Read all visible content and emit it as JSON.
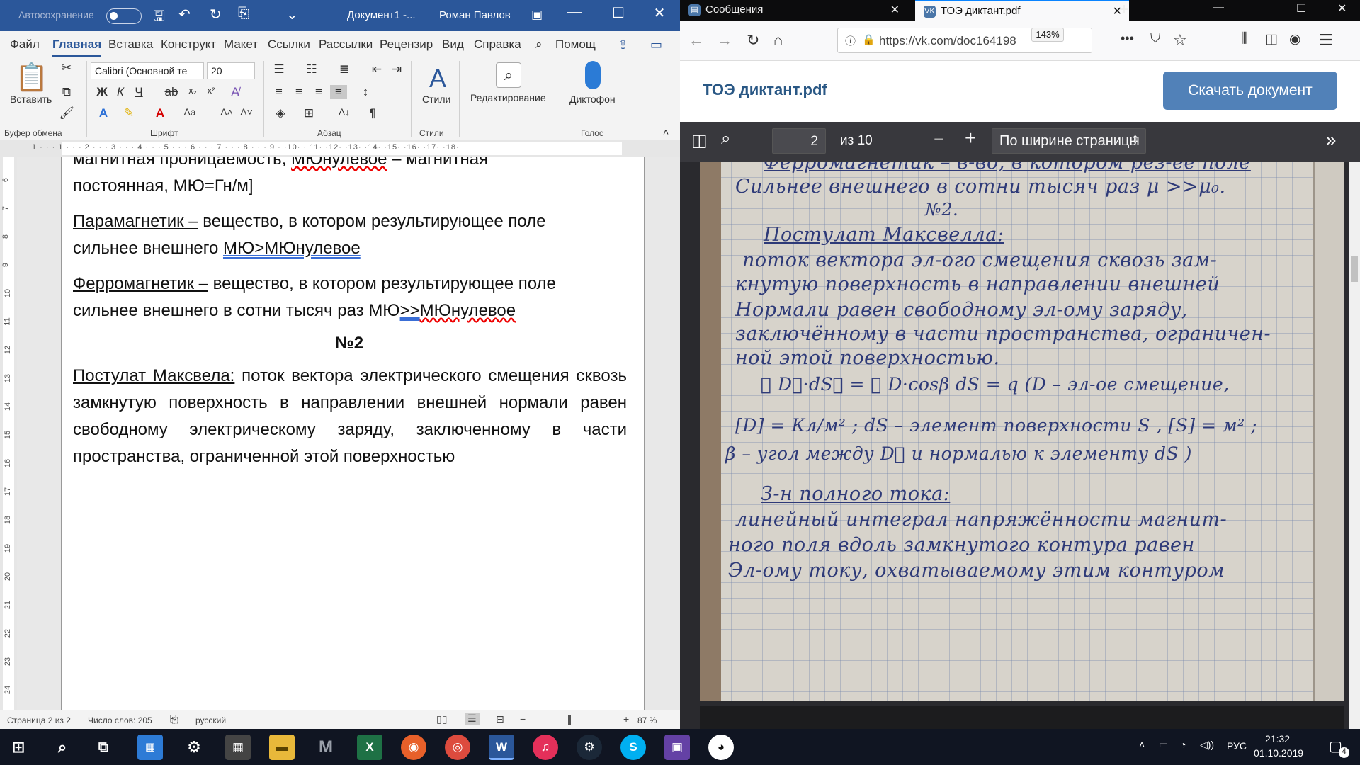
{
  "word": {
    "autosave_label": "Автосохранение",
    "doc_title": "Документ1  -...",
    "user_name": "Роман Павлов",
    "tabs": [
      "Файл",
      "Главная",
      "Вставка",
      "Конструкт",
      "Макет",
      "Ссылки",
      "Рассылки",
      "Рецензир",
      "Вид",
      "Справка",
      "Помощ"
    ],
    "ribbon": {
      "paste_label": "Вставить",
      "font_name": "Calibri (Основной те",
      "font_size": "20",
      "bold": "Ж",
      "italic": "К",
      "underline": "Ч",
      "strike": "ab",
      "styles_label": "Стили",
      "editing_label": "Редактирование",
      "dictate_label": "Диктофон",
      "groups": [
        "Буфер обмена",
        "Шрифт",
        "Абзац",
        "Стили",
        "Голос"
      ]
    },
    "ruler_numbers": "1 · · · 1 · · · 2 · · · 3 · · · 4 · · · 5 · · · 6 · · · 7 · · · 8 · · · 9 · ·10· · 11· ·12· ·13· ·14· ·15· ·16· ·17· ·18·",
    "vruler": [
      "6",
      "7",
      "8",
      "9",
      "10",
      "11",
      "12",
      "13",
      "14",
      "15",
      "16",
      "17",
      "18",
      "19",
      "20",
      "21",
      "22",
      "23",
      "24"
    ],
    "doc": {
      "cut_line_a": "магнитная проницаемость, ",
      "cut_line_b": "МЮнулевое",
      "cut_line_c": " – магнитная",
      "line2": "постоянная, МЮ=Гн/м]",
      "para_term": "Парамагнетик –",
      "para_text": " вещество, в котором результирующее поле",
      "para_line2a": "сильнее внешнего ",
      "para_line2b": "МЮ>МЮнулевое",
      "ferro_term": "Ферромагнетик –",
      "ferro_text": " вещество, в котором результирующее поле",
      "ferro_line2a": "сильнее внешнего в сотни тысяч раз МЮ",
      "ferro_line2b": ">>",
      "ferro_line2c": "МЮнулевое",
      "number": "№2",
      "maxwell_term": "Постулат Максвела:",
      "maxwell_text": " поток вектора электрического смещения сквозь замкнутую поверхность в направлении внешней нормали равен свободному электрическому заряду, заключенному в части пространства, ограниченной этой поверхностью "
    },
    "status": {
      "page": "Страница 2 из 2",
      "words": "Число слов: 205",
      "lang": "русский",
      "zoom": "87 %"
    }
  },
  "firefox": {
    "tabs": [
      {
        "title": "Сообщения"
      },
      {
        "title": "ТОЭ диктант.pdf"
      }
    ],
    "url": "https://vk.com/doc164198",
    "zoom": "143%",
    "vk_title": "ТОЭ диктант.pdf",
    "download_label": "Скачать документ",
    "pdf": {
      "page_num": "2",
      "page_total": "из 10",
      "fit_label": "По ширине страницы"
    },
    "handwriting": [
      "Ферромагнетик – в-во, в котором рез-ее поле",
      "Сильнее внешнего в сотни тысяч раз μ >>μ₀.",
      "№2.",
      "Постулат Максвелла:",
      "поток вектора эл-ого смещения сквозь зам-",
      "кнутую поверхность в направлении внешней",
      "Нормали равен свободному эл-ому заряду,",
      "заключённому в части пространства, ограничен-",
      "ной этой поверхностью.",
      "∮ D⃗·dS⃗ = ∮ D·cosβ dS = q   (D – эл-ое смещение,",
      "[D] = Кл/м² ; dS – элемент поверхности S , [S] = м² ;",
      "β – угол между D⃗ и нормалью к элементу dS )",
      "З-н полного тока:",
      "линейный интеграл напряжённости магнит-",
      "ного поля вдоль замкнутого контура равен",
      "Эл-ому току, охватываемому этим контуром"
    ]
  },
  "taskbar": {
    "lang": "РУС",
    "time": "21:32",
    "date": "01.10.2019",
    "notif_count": "4"
  }
}
